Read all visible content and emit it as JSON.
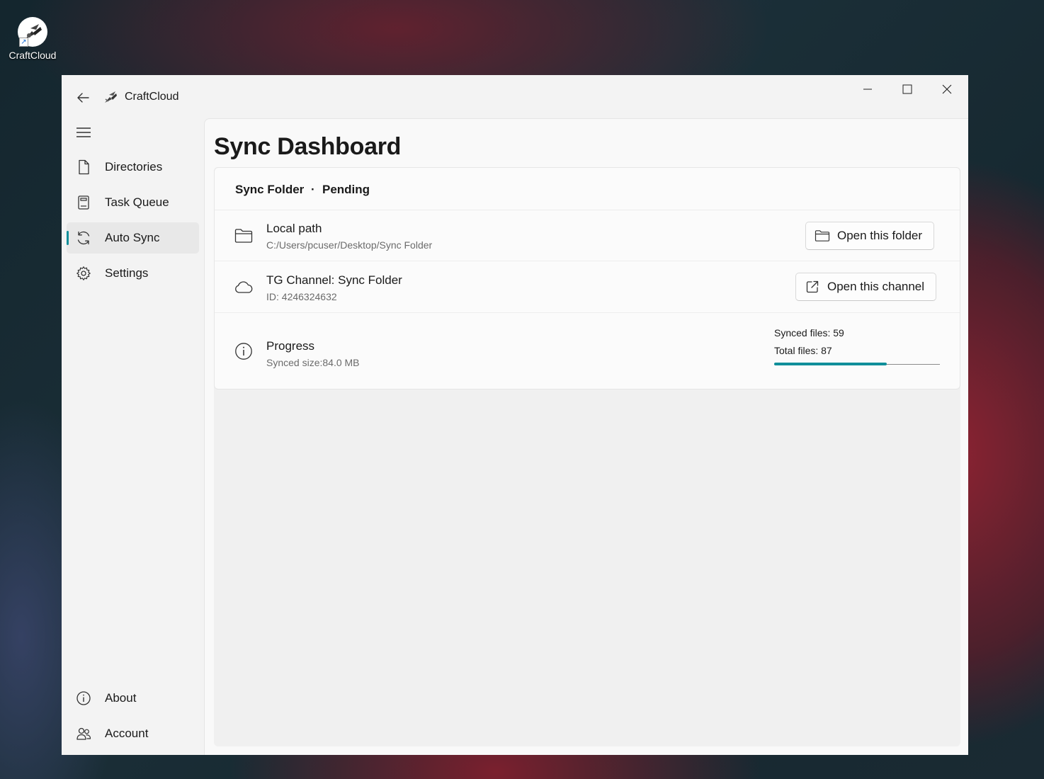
{
  "desktop": {
    "icon_label": "CraftCloud"
  },
  "window": {
    "app_title": "CraftCloud",
    "back_icon": "arrow-left-icon",
    "minimize_icon": "minimize-icon",
    "maximize_icon": "maximize-icon",
    "close_icon": "close-icon"
  },
  "sidebar": {
    "menu_icon": "hamburger-icon",
    "items": [
      {
        "label": "Directories",
        "icon": "document-icon"
      },
      {
        "label": "Task Queue",
        "icon": "clipboard-icon"
      },
      {
        "label": "Auto Sync",
        "icon": "sync-icon",
        "active": true
      },
      {
        "label": "Settings",
        "icon": "gear-icon"
      }
    ],
    "footer_items": [
      {
        "label": "About",
        "icon": "info-icon"
      },
      {
        "label": "Account",
        "icon": "people-icon"
      }
    ]
  },
  "main": {
    "page_title": "Sync Dashboard",
    "card": {
      "folder_name": "Sync Folder",
      "separator": "·",
      "status": "Pending",
      "local": {
        "title": "Local path",
        "path": "C:/Users/pcuser/Desktop/Sync Folder",
        "button_label": "Open this folder"
      },
      "channel": {
        "title": "TG Channel: Sync Folder",
        "id": "ID: 4246324632",
        "button_label": "Open this channel"
      },
      "progress": {
        "title": "Progress",
        "synced_size": "Synced size:84.0 MB",
        "synced_files_label": "Synced files: 59",
        "total_files_label": "Total files: 87",
        "synced_files": 59,
        "total_files": 87
      }
    }
  },
  "colors": {
    "accent": "#0f8f9a"
  }
}
